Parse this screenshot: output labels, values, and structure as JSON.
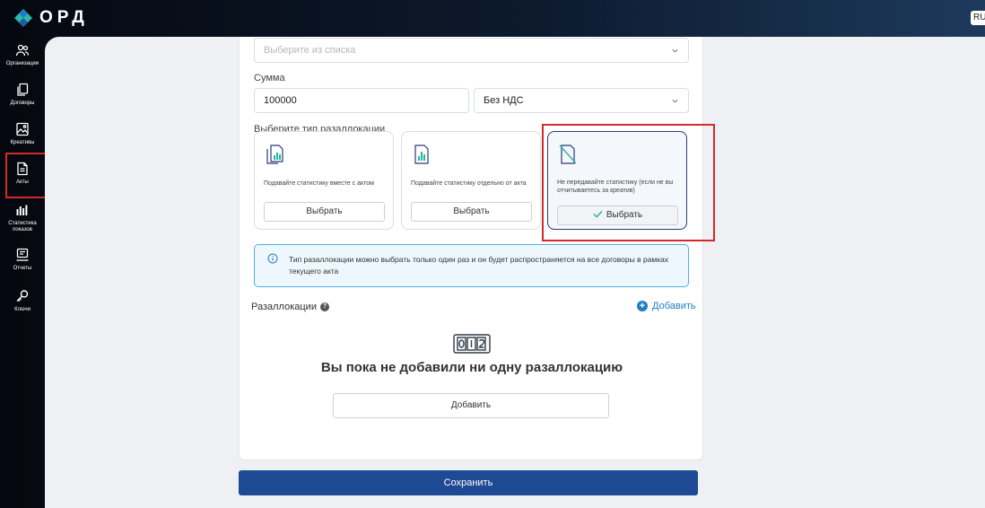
{
  "app": {
    "logo_text": "ОРД",
    "language": "RU"
  },
  "sidebar": {
    "items": [
      {
        "label": "Организации",
        "icon": "users-icon"
      },
      {
        "label": "Договоры",
        "icon": "documents-icon"
      },
      {
        "label": "Креативы",
        "icon": "image-icon"
      },
      {
        "label": "Акты",
        "icon": "document-icon"
      },
      {
        "label": "Статистика показов",
        "icon": "stats-icon"
      },
      {
        "label": "Отчеты",
        "icon": "report-icon"
      },
      {
        "label": "Ключи",
        "icon": "key-icon"
      }
    ]
  },
  "form": {
    "select_placeholder": "Выберите из списка",
    "sum_label": "Сумма",
    "sum_value": "100000",
    "vat_value": "Без НДС",
    "realloc_type_label": "Выберите тип разаллокации",
    "options": [
      {
        "text": "Подавайте статистику вместе с актом",
        "button": "Выбрать",
        "selected": false
      },
      {
        "text": "Подавайте статистику отдельно от акта",
        "button": "Выбрать",
        "selected": false
      },
      {
        "text": "Не передавайте статистику (если не вы отчитываетесь за креатив)",
        "button": "Выбрать",
        "selected": true
      }
    ],
    "info_text": "Тип разаллокации можно выбрать только один раз и он будет распространяется на все договоры в рамках текущего акта",
    "reallocations_title": "Разаллокации",
    "add_link": "Добавить",
    "empty_title": "Вы пока не добавили ни одну разаллокацию",
    "empty_button": "Добавить",
    "save_button": "Сохранить"
  },
  "colors": {
    "accent": "#1f7ec2",
    "save": "#1e4a94",
    "highlight": "#d32a2a",
    "teal": "#26b3a0"
  }
}
